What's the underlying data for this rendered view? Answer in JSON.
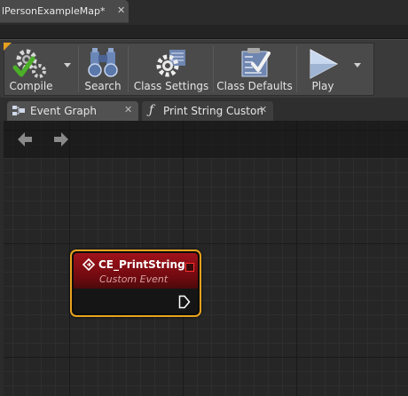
{
  "document_tab": {
    "title": "lPersonExampleMap*",
    "close": "✕"
  },
  "toolbar": {
    "compile_label": "Compile",
    "search_label": "Search",
    "class_settings_label": "Class Settings",
    "class_defaults_label": "Class Defaults",
    "play_label": "Play"
  },
  "graph_tabs": [
    {
      "label": "Event Graph",
      "close": "✕",
      "icon": "event-graph-icon"
    },
    {
      "label": "Print String Custon",
      "close": "✕",
      "icon": "function-icon"
    }
  ],
  "node": {
    "title": "CE_PrintString",
    "subtitle": "Custom Event",
    "header_color": "#a0121a",
    "border_color": "#e8a21e"
  },
  "colors": {
    "accent": "#e6a020",
    "compile_check": "#4caf28"
  }
}
